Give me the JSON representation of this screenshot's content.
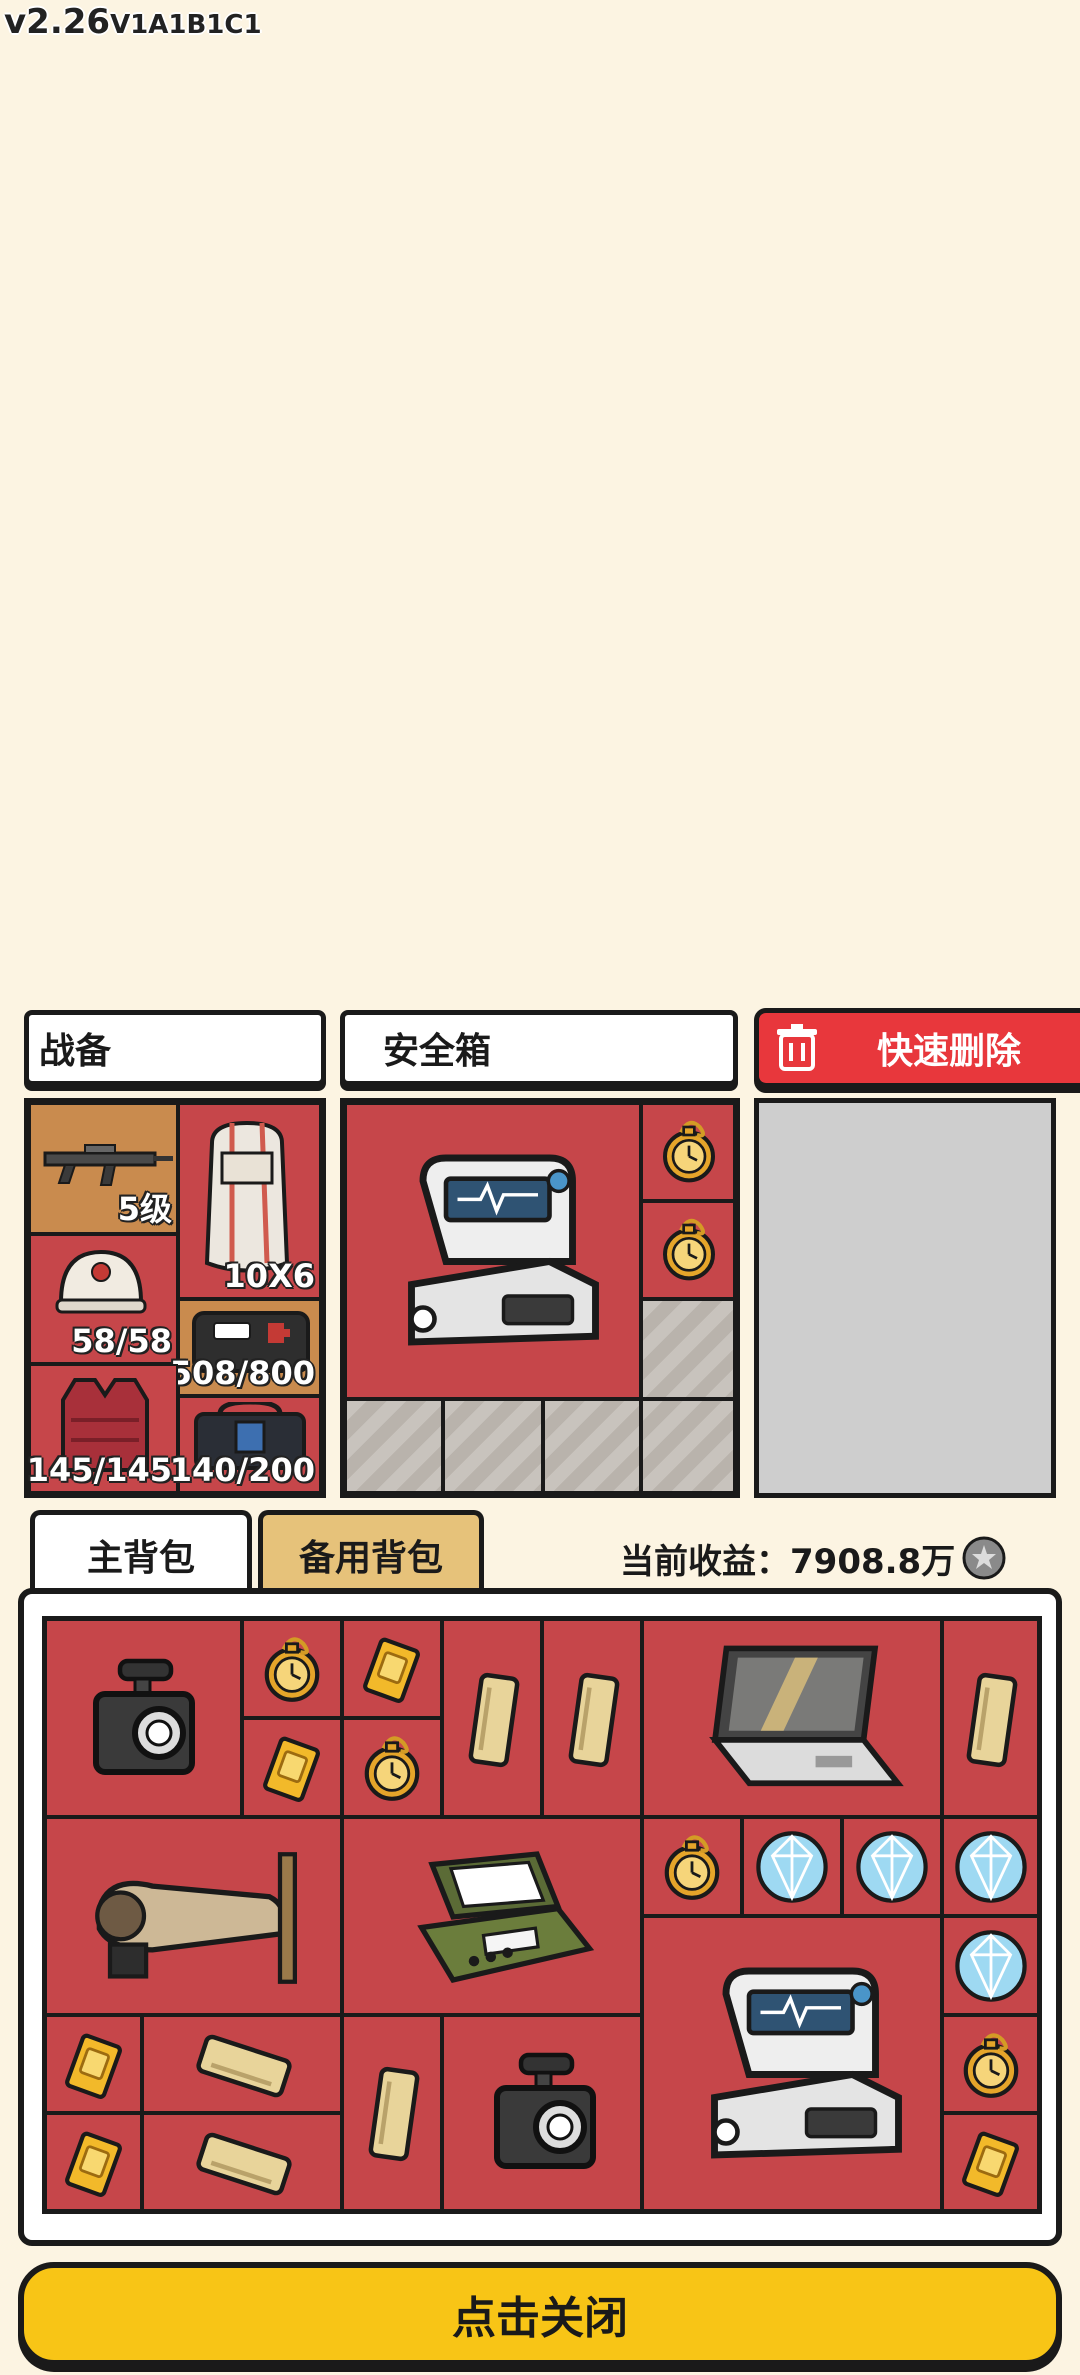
{
  "version": {
    "main": "v2.26",
    "suffix": "V1A1B1C1"
  },
  "equipment": {
    "label": "战备",
    "weapon_level": "5级",
    "backpack_size": "10X6",
    "helmet_durability": "58/58",
    "case_capacity": "508/800",
    "armor_durability": "145/145",
    "rig_capacity": "140/200"
  },
  "safebox": {
    "label": "安全箱"
  },
  "quick_delete": {
    "label": "快速删除"
  },
  "tabs": {
    "main_backpack": "主背包",
    "spare_backpack": "备用背包"
  },
  "earnings": {
    "label": "当前收益：",
    "value": "7908.8万"
  },
  "close_button": {
    "label": "点击关闭"
  },
  "colors": {
    "background": "#fcf4e2",
    "slot_red": "#c6464a",
    "delete_red": "#e8373c",
    "close_yellow": "#f8c516",
    "tab_tan": "#e6c27a"
  },
  "icons": [
    "trash-icon",
    "rifle-icon",
    "backpack-icon",
    "helmet-icon",
    "case-icon",
    "armor-vest-icon",
    "tactical-rig-icon",
    "monitor-device-icon",
    "pocket-watch-icon",
    "gold-bar-icon",
    "silver-bar-icon",
    "camera-icon",
    "laptop-icon",
    "diamond-icon",
    "oscilloscope-icon",
    "statue-icon",
    "coin-icon"
  ]
}
